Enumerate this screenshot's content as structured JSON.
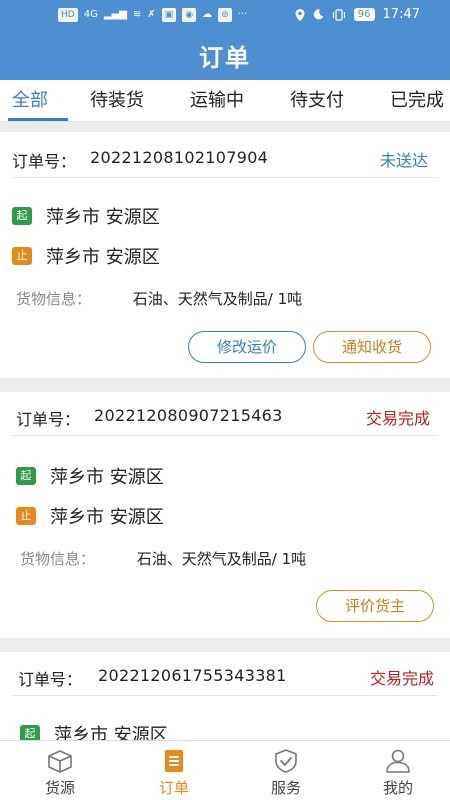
{
  "status_bar": {
    "left_items": [
      "HD",
      "4G",
      "▂▄▆",
      "≋",
      "✗",
      "▣",
      "◉",
      "☁",
      "⊚",
      "···"
    ],
    "battery": "96",
    "time": "17:47"
  },
  "header": {
    "title": "订单"
  },
  "tabs": [
    {
      "label": "全部"
    },
    {
      "label": "待装货"
    },
    {
      "label": "运输中"
    },
    {
      "label": "待支付"
    },
    {
      "label": "已完成"
    }
  ],
  "orders": [
    {
      "order_label": "订单号：",
      "order_no": "20221208102107904",
      "status": "未送达",
      "start_badge": "起",
      "start_place": "萍乡市 安源区",
      "stop_badge": "止",
      "stop_place": "萍乡市 安源区",
      "goods_label": "货物信息：",
      "goods_value": "石油、天然气及制品/ 1吨",
      "buttons": [
        "修改运价",
        "通知收货"
      ]
    },
    {
      "order_label": "订单号：",
      "order_no": "202212080907215463",
      "status": "交易完成",
      "start_badge": "起",
      "start_place": "萍乡市 安源区",
      "stop_badge": "止",
      "stop_place": "萍乡市 安源区",
      "goods_label": "货物信息：",
      "goods_value": "石油、天然气及制品/ 1吨",
      "buttons": [
        "评价货主"
      ]
    },
    {
      "order_label": "订单号：",
      "order_no": "202212061755343381",
      "status": "交易完成",
      "start_badge": "起",
      "start_place": "萍乡市 安源区"
    }
  ],
  "bottom_nav": [
    {
      "label": "货源",
      "icon": "box-icon"
    },
    {
      "label": "订单",
      "icon": "order-list-icon"
    },
    {
      "label": "服务",
      "icon": "shield-check-icon"
    },
    {
      "label": "我的",
      "icon": "user-icon"
    }
  ],
  "colors": {
    "primary": "#4d8fd0",
    "tab_active": "#3a7fc4",
    "status_red": "#c01e1e",
    "accent_orange": "#e88a1a",
    "badge_green": "#2e9c4a"
  }
}
